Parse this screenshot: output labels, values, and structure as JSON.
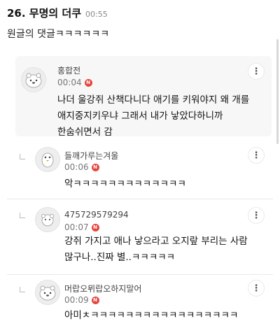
{
  "post": {
    "title": "26. 무명의 더쿠",
    "time": "00:55",
    "body": "원글의 댓글ㅋㅋㅋㅋㅋㅋ"
  },
  "badge": {
    "label": "N",
    "color": "#e8453c"
  },
  "comments": [
    {
      "name": "홍합전",
      "time": "00:04",
      "lines": [
        "나더 울강쥐 산책다니다 애기를 키워야지 왜 개를",
        "애지중지키우냐 그래서 내가 낳았다하니까",
        "한숨쉬면서 감"
      ]
    },
    {
      "name": "들깨가루는겨울",
      "time": "00:06",
      "lines": [
        "악ㅋㅋㅋㅋㅋㅋㅋㅋㅋㅋㅋㅋㅋ"
      ]
    },
    {
      "name": "475729579294",
      "time": "00:07",
      "lines": [
        "강쥐 가지고 애나 낳으라고 오지랖 부리는 사람",
        "많구나..진짜 별..ㅋㅋㅋㅋㅋ"
      ]
    },
    {
      "name": "머랍오뮈랍오하지말어",
      "time": "00:09",
      "lines": [
        "아미ㅊㅋㅋㅋㅋㅋㅋㅋㅋㅋㅋㅋㅋㅋㅋㅋㅋㅋ"
      ]
    }
  ],
  "more_icon": "more-vertical-icon",
  "avatar_icon": "user-avatar-icon",
  "reply_icon": "reply-indent-icon"
}
